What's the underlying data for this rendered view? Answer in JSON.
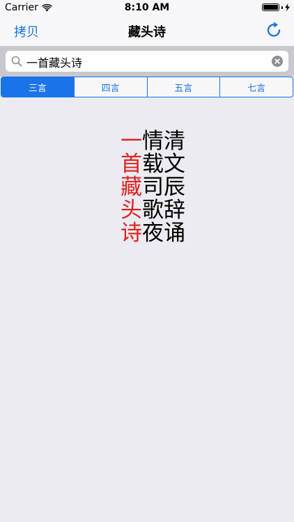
{
  "status_bar": {
    "carrier": "Carrier",
    "time": "8:10 AM",
    "icons": [
      "wifi-icon",
      "battery-icon",
      "charging-bolt-icon"
    ]
  },
  "nav": {
    "left_button": "拷贝",
    "title": "藏头诗",
    "right_icon": "refresh-icon",
    "accent_color": "#1a73e8"
  },
  "search": {
    "value": "一首藏头诗",
    "icon": "search-icon",
    "clear_icon": "clear-icon"
  },
  "segments": [
    {
      "label": "三言",
      "active": true
    },
    {
      "label": "四言",
      "active": false
    },
    {
      "label": "五言",
      "active": false
    },
    {
      "label": "七言",
      "active": false
    }
  ],
  "poem": {
    "head_color": "#e02020",
    "lines": [
      {
        "head": "一",
        "rest": "情清"
      },
      {
        "head": "首",
        "rest": "载文"
      },
      {
        "head": "藏",
        "rest": "司辰"
      },
      {
        "head": "头",
        "rest": "歌辞"
      },
      {
        "head": "诗",
        "rest": "夜诵"
      }
    ]
  }
}
